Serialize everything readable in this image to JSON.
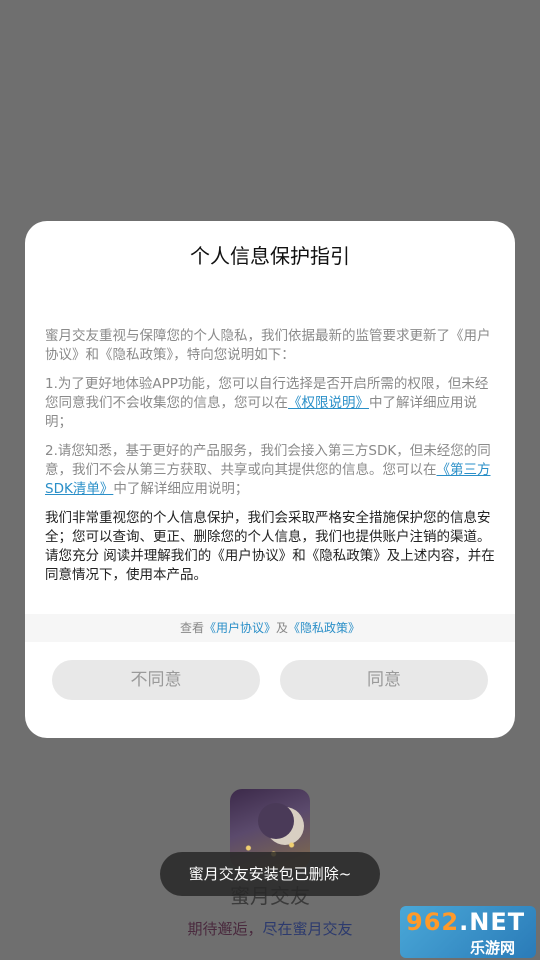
{
  "dialog": {
    "title": "个人信息保护指引",
    "p1": "蜜月交友重视与保障您的个人隐私，我们依据最新的监管要求更新了《用户协议》和《隐私政策》，特向您说明如下：",
    "p2_before": "1.为了更好地体验APP功能，您可以自行选择是否开启所需的权限，但未经您同意我们不会收集您的信息，您可以在",
    "p2_link": "《权限说明》",
    "p2_after": "中了解详细应用说明；",
    "p3_before": "2.请您知悉，基于更好的产品服务，我们会接入第三方SDK，但未经您的同意，我们不会从第三方获取、共享或向其提供您的信息。您可以在",
    "p3_link": "《第三方SDK清单》",
    "p3_after": "中了解详细应用说明；",
    "p4": "我们非常重视您的个人信息保护，我们会采取严格安全措施保护您的信息安全；您可以查询、更正、删除您的个人信息，我们也提供账户注销的渠道。请您充分 阅读并理解我们的《用户协议》和《隐私政策》及上述内容，并在同意情况下，使用本产品。",
    "hint_prefix": "查看",
    "hint_link1": "《用户协议》",
    "hint_mid": "及",
    "hint_link2": "《隐私政策》",
    "disagree": "不同意",
    "agree": "同意"
  },
  "background": {
    "app_name": "蜜月交友",
    "slogan_part1": "期待邂逅，",
    "slogan_part2": "尽在蜜月交友"
  },
  "toast": "蜜月交友安装包已删除~",
  "watermark": {
    "top_a": "962",
    "top_b": ".NET",
    "bottom": "乐游网"
  }
}
